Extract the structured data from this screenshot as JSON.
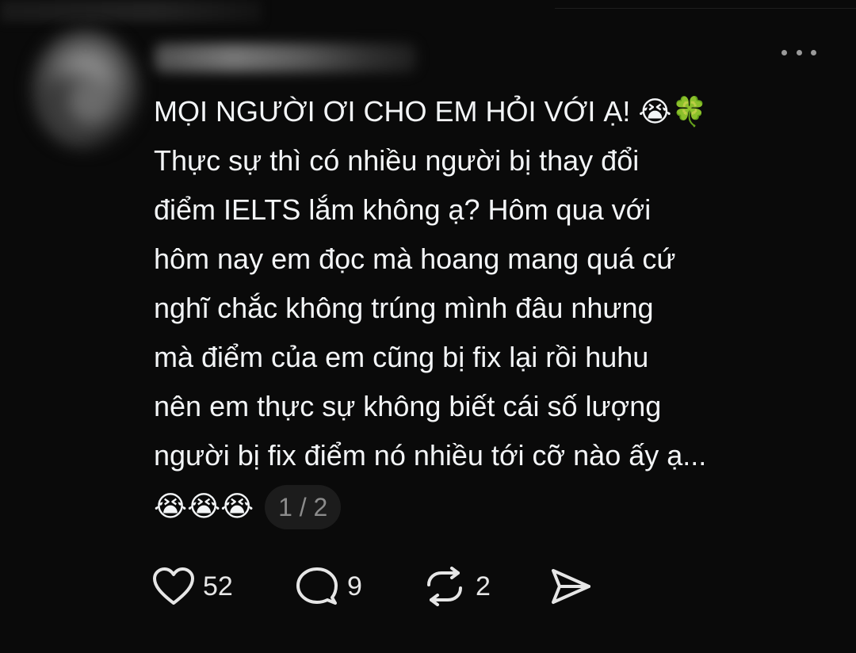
{
  "post": {
    "text": "MỌI NGƯỜI ƠI CHO EM HỎI VỚI Ạ! 😭🍀\nThực sự thì có nhiều người bị thay đổi\nđiểm IELTS lắm không ạ? Hôm qua với\nhôm nay em đọc mà hoang mang quá cứ\nnghĩ chắc không trúng mình đâu nhưng\nmà điểm của em cũng bị fix lại rồi huhu\nnên em thực sự không biết cái số lượng\nngười bị fix điểm nó nhiều tới cỡ nào ấy ạ...",
    "trailing_emojis": "😭😭😭",
    "page_indicator": "1 / 2"
  },
  "actions": {
    "likes": "52",
    "replies": "9",
    "reposts": "2"
  },
  "icons": {
    "more": "more-horizontal-icon",
    "like": "heart-icon",
    "reply": "comment-bubble-icon",
    "repost": "repost-icon",
    "share": "send-icon"
  },
  "colors": {
    "background": "#0a0a0a",
    "text": "#f3f5f7",
    "muted": "#8c8c8c",
    "chip": "#1c1c1c"
  }
}
